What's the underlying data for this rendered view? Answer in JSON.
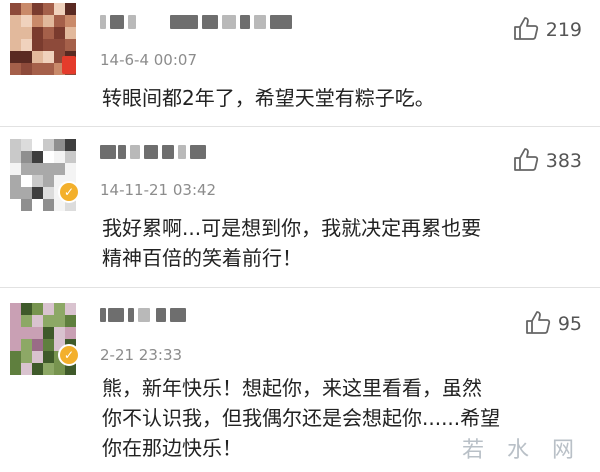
{
  "comments": [
    {
      "timestamp": "14-6-4 00:07",
      "text_lines": [
        "转眼间都2年了，希望天堂有粽子吃。"
      ],
      "like_count": "219",
      "badge": "red"
    },
    {
      "timestamp": "14-11-21 03:42",
      "text_lines": [
        "我好累啊...可是想到你，我就决定再累也要",
        "精神百倍的笑着前行！"
      ],
      "like_count": "383",
      "badge": "verified"
    },
    {
      "timestamp": "2-21 23:33",
      "text_lines": [
        "熊，新年快乐！想起你，来这里看看，虽然",
        "你不认识我，但我偶尔还是会想起你......希望",
        "你在那边快乐！"
      ],
      "like_count": "95",
      "badge": "verified"
    }
  ],
  "verified_badge_glyph": "✓",
  "watermark": "若 水 网",
  "colors": {
    "verified_badge": "#f3b02c",
    "red_badge": "#e43b2b",
    "meta_text": "#8c8c8c",
    "divider": "#e2e2e2"
  }
}
